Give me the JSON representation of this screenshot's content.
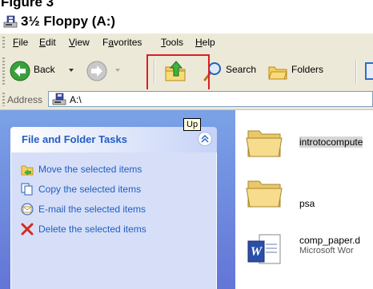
{
  "figure_label": "Figure 3",
  "window": {
    "title": "3½ Floppy (A:)",
    "title_icon": "floppy-drive-icon"
  },
  "menu": [
    {
      "label": "File",
      "underline": "F",
      "rest": "ile"
    },
    {
      "label": "Edit",
      "underline": "E",
      "rest": "dit"
    },
    {
      "label": "View",
      "underline": "V",
      "rest": "iew"
    },
    {
      "label": "Favorites",
      "underline": "a",
      "pre": "F",
      "rest": "vorites"
    },
    {
      "label": "Tools",
      "underline": "T",
      "rest": "ools"
    },
    {
      "label": "Help",
      "underline": "H",
      "rest": "elp"
    }
  ],
  "toolbar": {
    "back_label": "Back",
    "search_label": "Search",
    "folders_label": "Folders",
    "up_tooltip": "Up"
  },
  "address": {
    "label": "Address",
    "value": "A:\\"
  },
  "tasks_panel": {
    "title": "File and Folder Tasks",
    "items": [
      {
        "label": "Move the selected items",
        "icon": "move-folder-icon"
      },
      {
        "label": "Copy the selected items",
        "icon": "copy-document-icon"
      },
      {
        "label": "E-mail the selected items",
        "icon": "email-icon"
      },
      {
        "label": "Delete the selected items",
        "icon": "delete-x-icon"
      }
    ]
  },
  "files": [
    {
      "name": "introtocompute",
      "type": "folder"
    },
    {
      "name": "psa",
      "type": "folder"
    },
    {
      "name": "comp_paper.d",
      "subtitle": "Microsoft Wor",
      "type": "word-document"
    }
  ],
  "colors": {
    "highlight_box": "#d91f26",
    "panel_gradient_top": "#7ba2e7",
    "panel_title": "#215dc6",
    "toolbar_bg": "#ece9d8"
  }
}
